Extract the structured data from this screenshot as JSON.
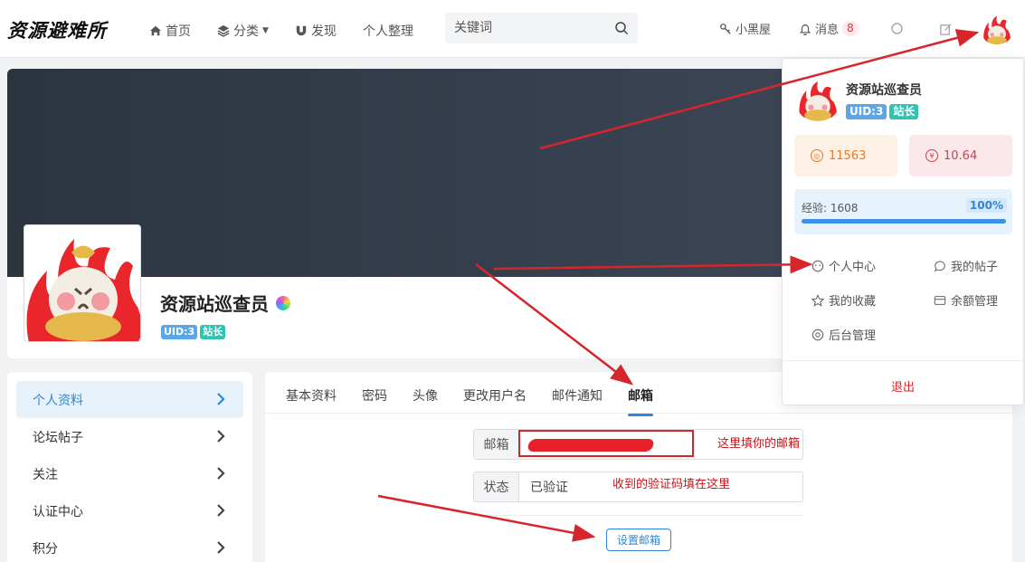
{
  "header": {
    "logo": "资源避难所",
    "nav": [
      {
        "label": "首页",
        "icon": "home-icon"
      },
      {
        "label": "分类",
        "icon": "layers-icon"
      },
      {
        "label": "发现",
        "icon": "magnet-icon"
      },
      {
        "label": "个人整理",
        "icon": ""
      }
    ],
    "search": {
      "placeholder": "关键词"
    },
    "blackroom": "小黑屋",
    "messages": "消息",
    "message_count": "8"
  },
  "profile": {
    "name": "资源站巡查员",
    "uid_tag": "UID:3",
    "role_tag": "站长"
  },
  "sidebar": {
    "items": [
      {
        "label": "个人资料"
      },
      {
        "label": "论坛帖子"
      },
      {
        "label": "关注"
      },
      {
        "label": "认证中心"
      },
      {
        "label": "积分"
      }
    ]
  },
  "tabs": [
    "基本资料",
    "密码",
    "头像",
    "更改用户名",
    "邮件通知",
    "邮箱"
  ],
  "form": {
    "email_label": "邮箱",
    "status_label": "状态",
    "status_value": "已验证",
    "submit": "设置邮箱"
  },
  "annotations": {
    "email_note": "这里填你的邮箱",
    "code_note": "收到的验证码填在这里"
  },
  "dropdown": {
    "name": "资源站巡查员",
    "uid_tag": "UID:3",
    "role_tag": "站长",
    "coins": "11563",
    "money": "10.64",
    "exp_label": "经验: 1608",
    "exp_percent": "100%",
    "exp_fraction": 1.0,
    "menu": [
      {
        "label": "个人中心",
        "icon": "smile-icon"
      },
      {
        "label": "我的帖子",
        "icon": "chat-icon"
      },
      {
        "label": "我的收藏",
        "icon": "star-icon"
      },
      {
        "label": "余额管理",
        "icon": "wallet-icon"
      },
      {
        "label": "后台管理",
        "icon": "settings-icon"
      }
    ],
    "logout": "退出"
  },
  "colors": {
    "accent": "#2f86d6",
    "annotation_red": "#d6252b",
    "banner": "#2c3440"
  }
}
